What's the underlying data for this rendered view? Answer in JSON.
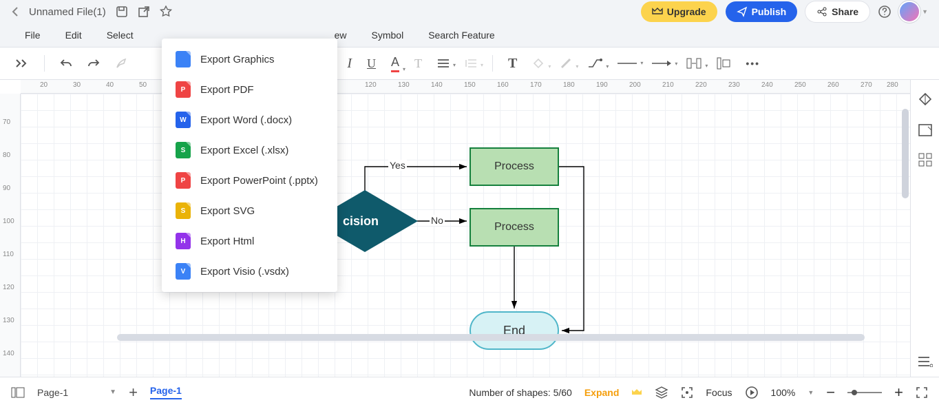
{
  "titlebar": {
    "filename": "Unnamed File(1)",
    "upgrade": "Upgrade",
    "publish": "Publish",
    "share": "Share"
  },
  "menu": {
    "file": "File",
    "edit": "Edit",
    "select": "Select",
    "view": "ew",
    "symbol": "Symbol",
    "search": "Search Feature"
  },
  "export": {
    "items": [
      {
        "label": "Export Graphics",
        "color": "#3b82f6"
      },
      {
        "label": "Export PDF",
        "color": "#ef4444"
      },
      {
        "label": "Export Word (.docx)",
        "color": "#2563eb"
      },
      {
        "label": "Export Excel (.xlsx)",
        "color": "#16a34a"
      },
      {
        "label": "Export PowerPoint (.pptx)",
        "color": "#ef4444"
      },
      {
        "label": "Export SVG",
        "color": "#eab308"
      },
      {
        "label": "Export Html",
        "color": "#9333ea"
      },
      {
        "label": "Export Visio (.vsdx)",
        "color": "#3b82f6"
      }
    ]
  },
  "ruler": {
    "top": [
      "20",
      "30",
      "40",
      "50",
      "120",
      "130",
      "140",
      "150",
      "160",
      "170",
      "180",
      "190",
      "200",
      "210",
      "220",
      "230",
      "240",
      "250",
      "260",
      "270",
      "280"
    ],
    "left": [
      "70",
      "80",
      "90",
      "100",
      "110",
      "120",
      "130",
      "140"
    ]
  },
  "shapes": {
    "decision": "cision",
    "process1": "Process",
    "process2": "Process",
    "end": "End",
    "yes": "Yes",
    "no": "No"
  },
  "bottom": {
    "pageSel": "Page-1",
    "tab": "Page-1",
    "shapesCount": "Number of shapes: 5/60",
    "expand": "Expand",
    "focus": "Focus",
    "zoom": "100%"
  }
}
